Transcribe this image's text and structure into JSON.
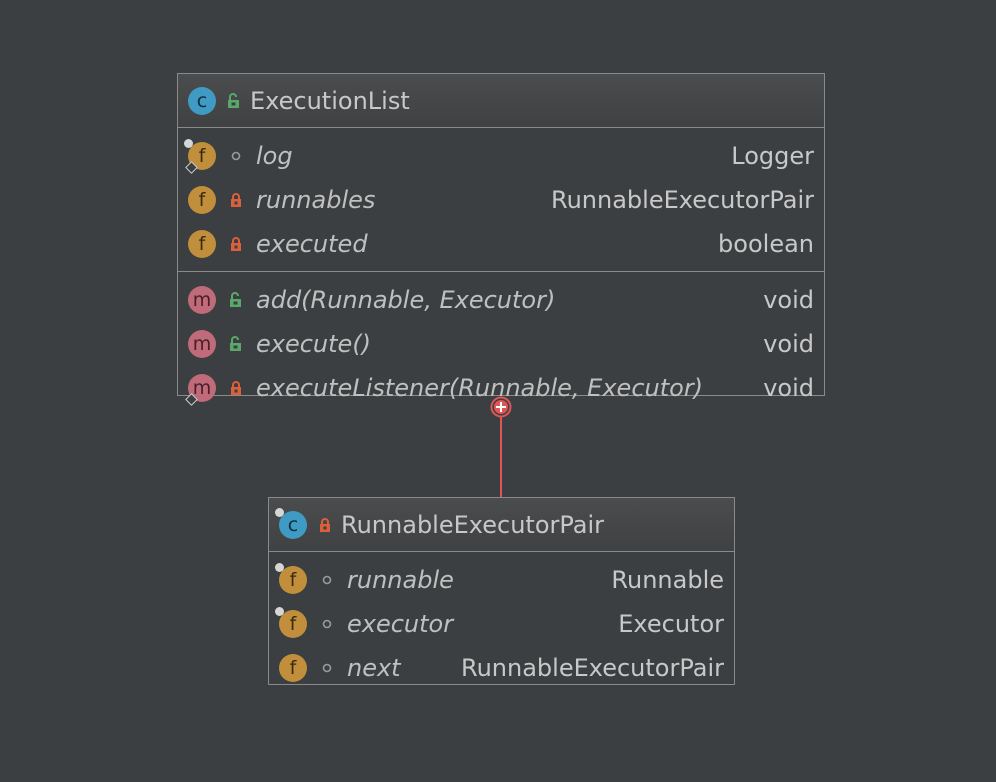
{
  "classes": [
    {
      "name": "ExecutionList",
      "icon": "class-icon",
      "visibility": "public",
      "fields": [
        {
          "name": "log",
          "type": "Logger",
          "visibility": "package",
          "static": true
        },
        {
          "name": "runnables",
          "type": "RunnableExecutorPair",
          "visibility": "private",
          "static": false
        },
        {
          "name": "executed",
          "type": "boolean",
          "visibility": "private",
          "static": false
        }
      ],
      "methods": [
        {
          "name": "add(Runnable, Executor)",
          "type": "void",
          "visibility": "public",
          "static": false
        },
        {
          "name": "execute()",
          "type": "void",
          "visibility": "public",
          "static": false
        },
        {
          "name": "executeListener(Runnable, Executor)",
          "type": "void",
          "visibility": "private",
          "static": true
        }
      ]
    },
    {
      "name": "RunnableExecutorPair",
      "icon": "static-class-icon",
      "visibility": "private",
      "fields": [
        {
          "name": "runnable",
          "type": "Runnable",
          "visibility": "package",
          "final": true
        },
        {
          "name": "executor",
          "type": "Executor",
          "visibility": "package",
          "final": true
        },
        {
          "name": "next",
          "type": "RunnableExecutorPair",
          "visibility": "package",
          "final": false
        }
      ],
      "methods": []
    }
  ],
  "relation": {
    "type": "inner-class",
    "from": "ExecutionList",
    "to": "RunnableExecutorPair"
  },
  "colors": {
    "background": "#3c3f41",
    "field_icon": "#c18f3b",
    "method_icon": "#c06b7a",
    "class_icon": "#3f9bc4",
    "public_lock": "#59a869",
    "private_lock": "#d9603b",
    "connector": "#e05555"
  }
}
